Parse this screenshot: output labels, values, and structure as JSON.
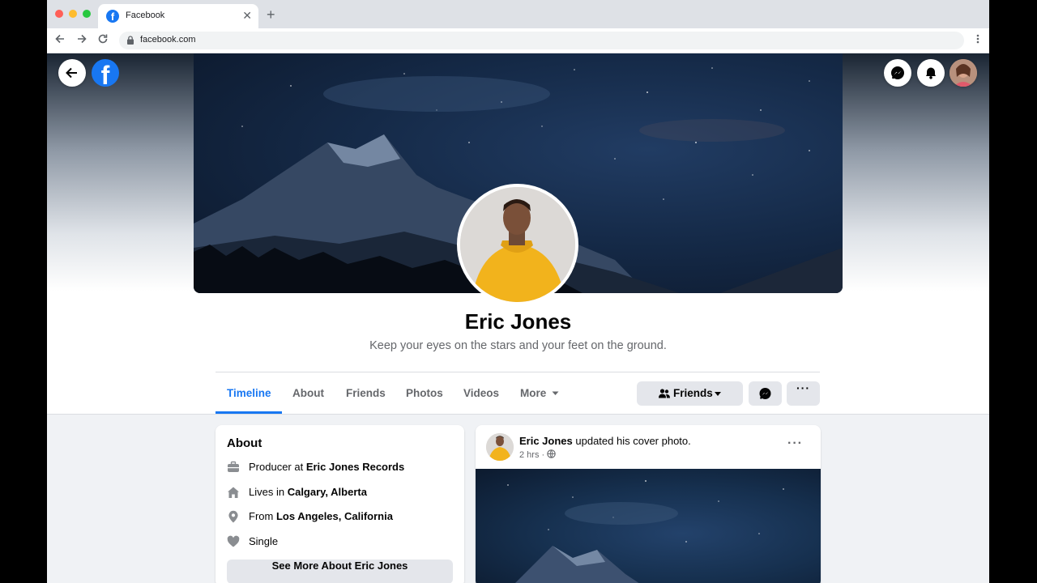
{
  "browser": {
    "tab_title": "Facebook",
    "tab_favicon": "f",
    "close_glyph": "✕",
    "new_tab_glyph": "+",
    "url": "facebook.com"
  },
  "profile": {
    "name": "Eric Jones",
    "bio": "Keep your eyes on the stars and your feet on the ground."
  },
  "fb_logo": "f",
  "nav": {
    "tabs": [
      {
        "label": "Timeline",
        "active": true
      },
      {
        "label": "About"
      },
      {
        "label": "Friends"
      },
      {
        "label": "Photos"
      },
      {
        "label": "Videos"
      },
      {
        "label": "More"
      }
    ],
    "friends_button": "Friends",
    "more_options": "···"
  },
  "about": {
    "title": "About",
    "rows": [
      {
        "icon": "briefcase-icon",
        "prefix": "Producer at ",
        "bold": "Eric Jones Records"
      },
      {
        "icon": "home-icon",
        "prefix": "Lives in ",
        "bold": "Calgary, Alberta"
      },
      {
        "icon": "location-pin-icon",
        "prefix": "From ",
        "bold": "Los Angeles, California"
      },
      {
        "icon": "heart-icon",
        "prefix": "",
        "bold": "",
        "plain": "Single"
      }
    ],
    "see_more": "See More About Eric Jones"
  },
  "post": {
    "author": "Eric Jones",
    "action": " updated his cover photo.",
    "time": "2 hrs",
    "separator": "·",
    "menu": "···"
  },
  "colors": {
    "brand": "#1877f2",
    "text_secondary": "#65676b",
    "button_gray": "#e4e6eb"
  }
}
